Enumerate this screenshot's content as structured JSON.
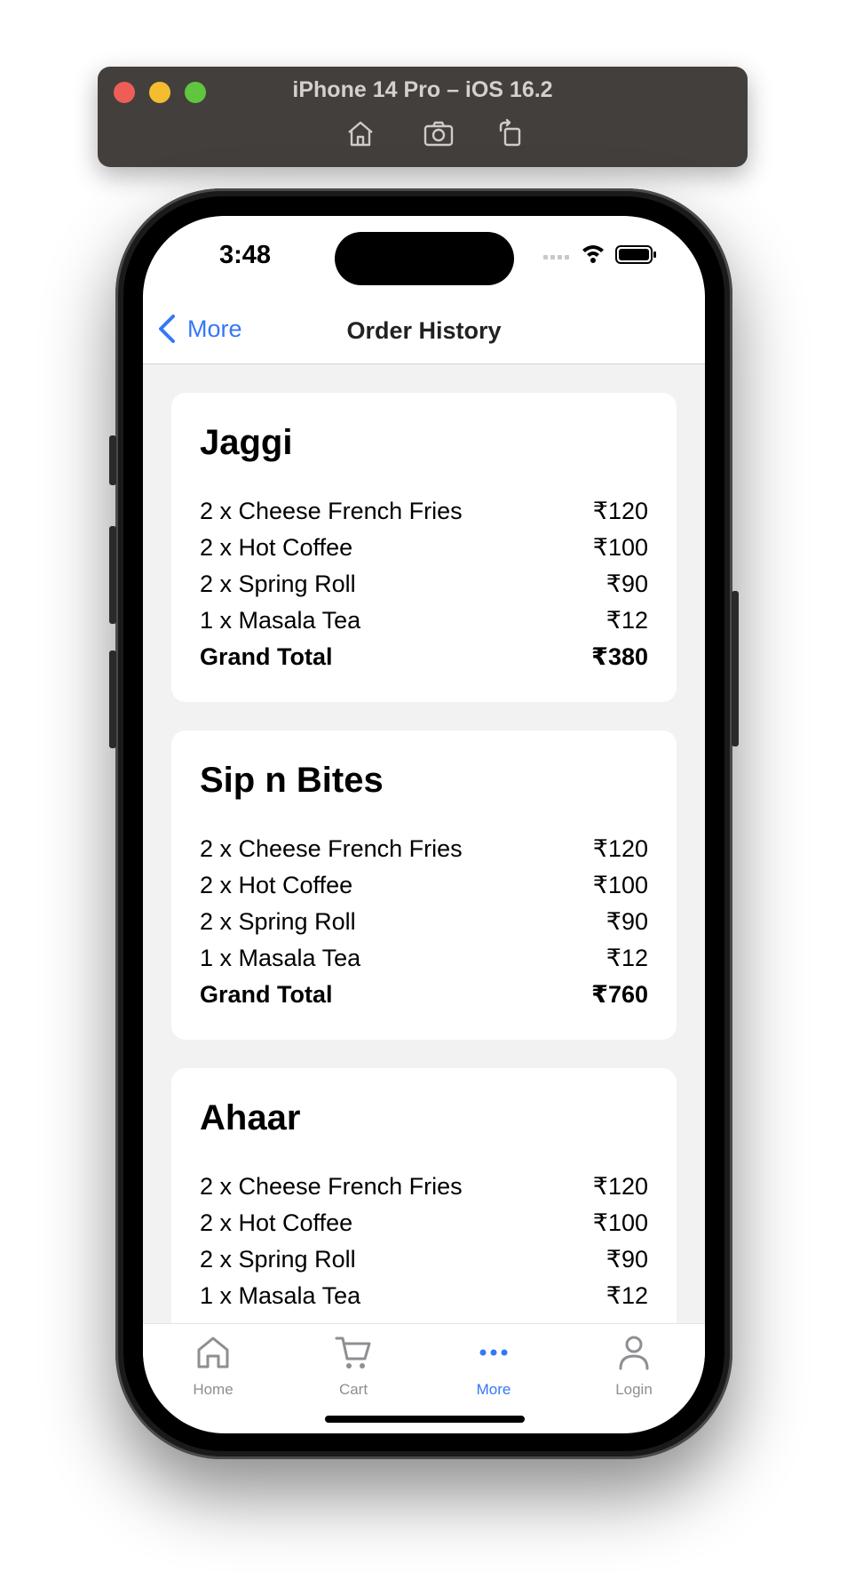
{
  "simulator": {
    "title": "iPhone 14 Pro – iOS 16.2",
    "tools": [
      "home-icon",
      "screenshot-icon",
      "rotate-icon"
    ]
  },
  "statusbar": {
    "time": "3:48"
  },
  "navbar": {
    "back_label": "More",
    "title": "Order History"
  },
  "orders": [
    {
      "restaurant": "Jaggi",
      "items": [
        {
          "label": "2 x Cheese French Fries",
          "price": "₹120"
        },
        {
          "label": "2 x Hot Coffee",
          "price": "₹100"
        },
        {
          "label": "2 x Spring Roll",
          "price": "₹90"
        },
        {
          "label": "1 x Masala Tea",
          "price": "₹12"
        }
      ],
      "total_label": "Grand Total",
      "total": "₹380"
    },
    {
      "restaurant": "Sip n Bites",
      "items": [
        {
          "label": "2 x Cheese French Fries",
          "price": "₹120"
        },
        {
          "label": "2 x Hot Coffee",
          "price": "₹100"
        },
        {
          "label": "2 x Spring Roll",
          "price": "₹90"
        },
        {
          "label": "1 x Masala Tea",
          "price": "₹12"
        }
      ],
      "total_label": "Grand Total",
      "total": "₹760"
    },
    {
      "restaurant": "Ahaar",
      "items": [
        {
          "label": "2 x Cheese French Fries",
          "price": "₹120"
        },
        {
          "label": "2 x Hot Coffee",
          "price": "₹100"
        },
        {
          "label": "2 x Spring Roll",
          "price": "₹90"
        },
        {
          "label": "1 x Masala Tea",
          "price": "₹12"
        }
      ]
    }
  ],
  "tabbar": {
    "tabs": [
      {
        "label": "Home",
        "icon": "home-icon",
        "active": false
      },
      {
        "label": "Cart",
        "icon": "cart-icon",
        "active": false
      },
      {
        "label": "More",
        "icon": "more-icon",
        "active": true
      },
      {
        "label": "Login",
        "icon": "person-icon",
        "active": false
      }
    ]
  },
  "colors": {
    "accent": "#3478f6",
    "inactive": "#8e8e93",
    "background": "#f2f2f2",
    "card": "#ffffff"
  }
}
